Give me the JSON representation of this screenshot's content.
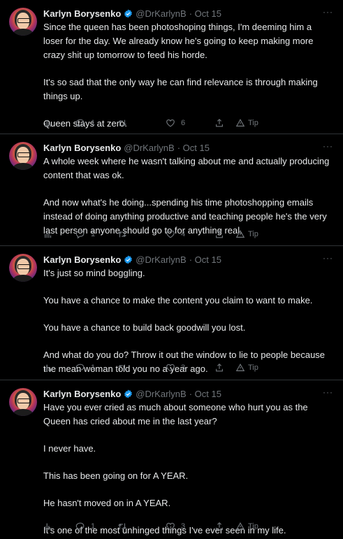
{
  "tweets": [
    {
      "name": "Karlyn Borysenko",
      "handle": "@DrKarlynB",
      "time": "· Oct 15",
      "verified": true,
      "paragraphs": [
        "Since the queen has been photoshoping things, I'm deeming him a loser for the day. We already know he's going to keep making more crazy shit up tomorrow to feed his horde.",
        "It's so sad that the only way he can find relevance is through making things up.",
        "Queen stays at zero."
      ],
      "replies": "1",
      "retweets": "",
      "likes": "6",
      "tip_label": "Tip"
    },
    {
      "name": "Karlyn Borysenko",
      "handle": "@DrKarlynB",
      "time": "· Oct 15",
      "verified": false,
      "paragraphs": [
        "A whole week where he wasn't talking about me and actually producing content that was ok.",
        "And now what's he doing...spending his time photoshopping emails instead of doing anything productive and teaching people he's the very last person anyone should go to for anything real."
      ],
      "replies": "1",
      "retweets": "",
      "likes": "4",
      "tip_label": "Tip"
    },
    {
      "name": "Karlyn Borysenko",
      "handle": "@DrKarlynB",
      "time": "· Oct 15",
      "verified": true,
      "paragraphs": [
        "It's just so mind boggling.",
        "You have a chance to make the content you claim to want to make.",
        "You have a chance to build back goodwill you lost.",
        "And what do you do? Throw it out the window to lie to people because the mean woman told you no a year ago."
      ],
      "replies": "1",
      "retweets": "",
      "likes": "3",
      "tip_label": "Tip"
    },
    {
      "name": "Karlyn Borysenko",
      "handle": "@DrKarlynB",
      "time": "· Oct 15",
      "verified": true,
      "paragraphs": [
        "Have you ever cried as much about someone who hurt you as the Queen has cried about me in the last year?",
        "I never have.",
        "This has been going on for A YEAR.",
        "He hasn't moved on in A YEAR.",
        "It's one of the most unhinged things I've ever seen in my life."
      ],
      "replies": "1",
      "retweets": "",
      "likes": "3",
      "tip_label": "Tip"
    }
  ],
  "colors": {
    "background": "#000000",
    "text": "#e7e9ea",
    "muted": "#71767b",
    "verified": "#1d9bf0",
    "divider": "#2f3336"
  },
  "icons": {
    "views": "bar-chart-icon",
    "reply": "speech-bubble-icon",
    "retweet": "retweet-arrows-icon",
    "like": "heart-icon",
    "share": "share-upload-icon",
    "tip": "tip-triangle-icon",
    "more": "ellipsis-icon",
    "verified": "verified-badge-icon"
  }
}
